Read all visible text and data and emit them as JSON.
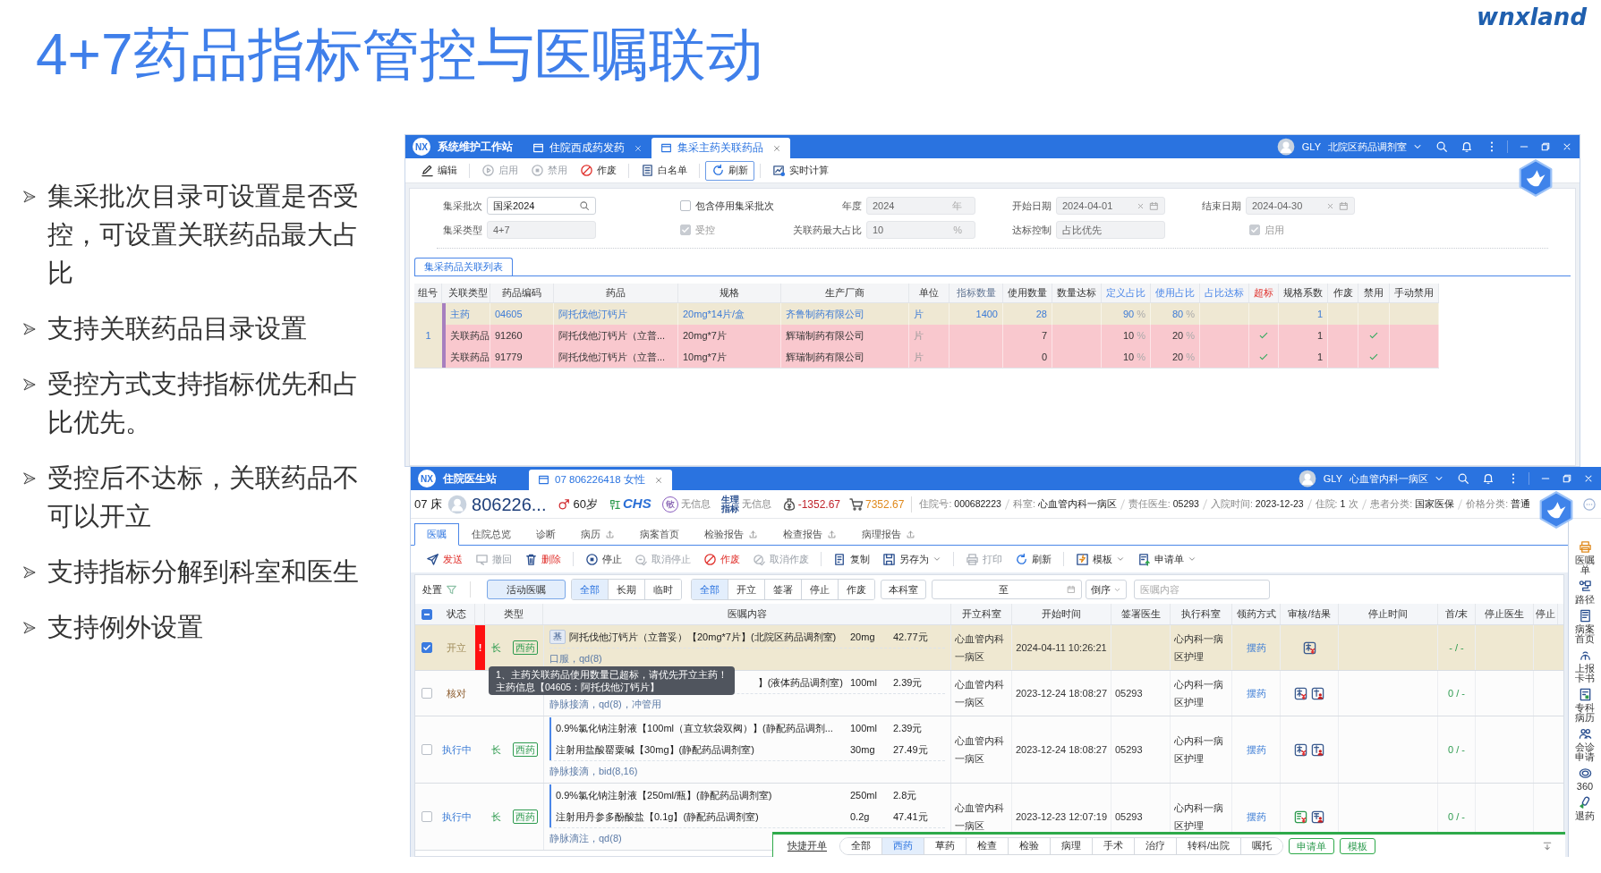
{
  "slide": {
    "title": "4+7药品指标管控与医嘱联动",
    "logo": "wnxland",
    "bullets": [
      "集采批次目录可设置是否受控，可设置关联药品最大占比",
      "支持关联药品目录设置",
      "受控方式支持指标优先和占比优先。",
      "受控后不达标，关联药品不可以开立",
      "支持指标分解到科室和医生",
      "支持例外设置"
    ]
  },
  "config_window": {
    "logo": "NX",
    "app_title": "系统维护工作站",
    "tabs": [
      {
        "label": "住院西成药发药",
        "selected": false
      },
      {
        "label": "集采主药关联药品",
        "selected": true
      }
    ],
    "user": "GLY",
    "department": "北院区药品调剂室",
    "toolbar_groups": [
      [
        {
          "label": "编辑",
          "disabled": false,
          "focused": false
        }
      ],
      [
        {
          "label": "启用",
          "disabled": true,
          "focused": false
        },
        {
          "label": "禁用",
          "disabled": true,
          "focused": false
        },
        {
          "label": "作废",
          "disabled": false,
          "focused": false
        }
      ],
      [
        {
          "label": "白名单",
          "disabled": false,
          "focused": false
        }
      ],
      [
        {
          "label": "刷新",
          "disabled": false,
          "focused": true
        }
      ],
      [
        {
          "label": "实时计算",
          "disabled": false,
          "focused": false
        }
      ]
    ],
    "form_rows": [
      [
        {
          "kind": "search",
          "label": "集采批次",
          "value": "国采2024",
          "disabled": false
        },
        {
          "kind": "checkbox",
          "label": "包含停用集采批次",
          "checked": false,
          "disabled": false
        },
        {
          "kind": "text",
          "label": "年度",
          "value": "2024",
          "suffix": "年",
          "disabled": true
        },
        {
          "kind": "date",
          "label": "开始日期",
          "value": "2024-04-01",
          "disabled": true
        },
        {
          "kind": "date",
          "label": "结束日期",
          "value": "2024-04-30",
          "disabled": true
        }
      ],
      [
        {
          "kind": "text",
          "label": "集采类型",
          "value": "4+7",
          "disabled": true
        },
        {
          "kind": "checkbox",
          "label": "受控",
          "checked": true,
          "disabled": true
        },
        {
          "kind": "text",
          "label": "关联药最大占比",
          "value": "10",
          "suffix": "%",
          "disabled": true
        },
        {
          "kind": "text",
          "label": "达标控制",
          "value": "占比优先",
          "disabled": true
        },
        {
          "kind": "checkbox",
          "label": "启用",
          "checked": true,
          "disabled": true
        }
      ]
    ],
    "list_tabs": [
      {
        "label": "集采药品关联列表",
        "selected": true
      }
    ],
    "columns": [
      {
        "label": "组号",
        "kind": "plain"
      },
      {
        "label": "关联类型",
        "kind": "plain"
      },
      {
        "label": "药品编码",
        "kind": "plain"
      },
      {
        "label": "药品",
        "kind": "plain"
      },
      {
        "label": "规格",
        "kind": "plain"
      },
      {
        "label": "生产厂商",
        "kind": "plain"
      },
      {
        "label": "单位",
        "kind": "plain"
      },
      {
        "label": "指标数量",
        "kind": "quota"
      },
      {
        "label": "使用数量",
        "kind": "plain"
      },
      {
        "label": "数量达标",
        "kind": "plain"
      },
      {
        "label": "定义占比",
        "kind": "ratio"
      },
      {
        "label": "使用占比",
        "kind": "ratio"
      },
      {
        "label": "占比达标",
        "kind": "ratio"
      },
      {
        "label": "超标",
        "kind": "alert"
      },
      {
        "label": "规格系数",
        "kind": "plain"
      },
      {
        "label": "作废",
        "kind": "plain"
      },
      {
        "label": "禁用",
        "kind": "plain"
      },
      {
        "label": "手动禁用",
        "kind": "plain"
      }
    ],
    "groups": [
      {
        "number": "1",
        "rows": [
          {
            "kind": "main",
            "type": "主药",
            "code": "04605",
            "drug": "阿托伐他汀钙片",
            "spec": "20mg*14片/盒",
            "maker": "齐鲁制药有限公司",
            "unit": "片",
            "target_qty": "1400",
            "used_qty": "28",
            "defined_ratio": {
              "value": "90",
              "unit": "%"
            },
            "used_ratio": {
              "value": "80",
              "unit": "%"
            },
            "over_limit": false,
            "factor": "1",
            "banned": false
          },
          {
            "kind": "linked",
            "type": "关联药品",
            "code": "91260",
            "drug": "阿托伐他汀钙片（立普...",
            "spec": "20mg*7片",
            "maker": "辉瑞制药有限公司",
            "unit": "片",
            "used_qty": "7",
            "defined_ratio": {
              "value": "10",
              "unit": "%"
            },
            "used_ratio": {
              "value": "20",
              "unit": "%"
            },
            "over_limit": true,
            "factor": "1",
            "banned": true
          },
          {
            "kind": "linked",
            "type": "关联药品",
            "code": "91779",
            "drug": "阿托伐他汀钙片（立普...",
            "spec": "10mg*7片",
            "maker": "辉瑞制药有限公司",
            "unit": "片",
            "used_qty": "0",
            "defined_ratio": {
              "value": "10",
              "unit": "%"
            },
            "used_ratio": {
              "value": "20",
              "unit": "%"
            },
            "over_limit": true,
            "factor": "1",
            "banned": true
          }
        ]
      }
    ]
  },
  "doctor_window": {
    "logo": "NX",
    "app_title": "住院医生站",
    "tabs": [
      {
        "label": "07 806226418 女性",
        "selected": true
      }
    ],
    "user": "GLY",
    "department": "心血管内科一病区",
    "patient": {
      "bed": "07 床",
      "id": "806226...",
      "age": "60岁",
      "insurance": "CHS",
      "allergy_badge": "敏",
      "allergy": "无信息",
      "vitals_badge": "生理指标",
      "vitals": "无信息",
      "balance": "-1352.67",
      "cost": "7352.67",
      "info": [
        {
          "label": "住院号:",
          "value": "000682223"
        },
        {
          "label": "科室:",
          "value": "心血管内科一病区"
        },
        {
          "label": "责任医生:",
          "value": "05293"
        },
        {
          "label": "入院时间:",
          "value": "2023-12-23"
        },
        {
          "label": "住院:",
          "value": "1",
          "suffix": "次"
        },
        {
          "label": "患者分类:",
          "value": "国家医保"
        },
        {
          "label": "价格分类:",
          "value": "普通"
        }
      ]
    },
    "record_tabs": [
      {
        "label": "医嘱",
        "selected": true,
        "upload": false
      },
      {
        "label": "住院总览",
        "selected": false,
        "upload": false
      },
      {
        "label": "诊断",
        "selected": false,
        "upload": false
      },
      {
        "label": "病历",
        "selected": false,
        "upload": true
      },
      {
        "label": "病案首页",
        "selected": false,
        "upload": false
      },
      {
        "label": "检验报告",
        "selected": false,
        "upload": true
      },
      {
        "label": "检查报告",
        "selected": false,
        "upload": true
      },
      {
        "label": "病理报告",
        "selected": false,
        "upload": true
      }
    ],
    "toolbar_groups": [
      [
        {
          "label": "发送",
          "kind": "danger",
          "disabled": false,
          "dropdown": false
        },
        {
          "label": "撤回",
          "disabled": true,
          "dropdown": false
        },
        {
          "label": "删除",
          "kind": "danger",
          "disabled": false,
          "dropdown": false
        }
      ],
      [
        {
          "label": "停止",
          "kind": "plain",
          "disabled": false,
          "dropdown": false
        },
        {
          "label": "取消停止",
          "disabled": true,
          "dropdown": false
        },
        {
          "label": "作废",
          "kind": "danger",
          "disabled": false,
          "dropdown": false
        },
        {
          "label": "取消作废",
          "disabled": true,
          "dropdown": false
        }
      ],
      [
        {
          "label": "复制",
          "kind": "plain",
          "disabled": false,
          "dropdown": false
        },
        {
          "label": "另存为",
          "kind": "plain",
          "disabled": false,
          "dropdown": true
        }
      ],
      [
        {
          "label": "打印",
          "disabled": true,
          "dropdown": false
        },
        {
          "label": "刷新",
          "kind": "plain",
          "disabled": false,
          "dropdown": false
        }
      ],
      [
        {
          "label": "模板",
          "kind": "plain",
          "disabled": false,
          "dropdown": true
        },
        {
          "label": "申请单",
          "kind": "plain",
          "disabled": false,
          "dropdown": true
        }
      ]
    ],
    "filters": {
      "label": "处置",
      "scope": {
        "label": "活动医嘱",
        "selected": true
      },
      "durations": [
        {
          "label": "全部",
          "selected": true
        },
        {
          "label": "长期",
          "selected": false
        },
        {
          "label": "临时",
          "selected": false
        }
      ],
      "statuses": [
        {
          "label": "全部",
          "selected": true
        },
        {
          "label": "开立",
          "selected": false
        },
        {
          "label": "签署",
          "selected": false
        },
        {
          "label": "停止",
          "selected": false
        },
        {
          "label": "作废",
          "selected": false
        }
      ],
      "dept_button": "本科室",
      "range_separator": "至",
      "order": "倒序",
      "search_placeholder": "医嘱内容"
    },
    "select_all": {
      "checked": true,
      "partial": true
    },
    "columns": [
      "状态",
      "类型",
      "医嘱内容",
      "开立科室",
      "开始时间",
      "签署医生",
      "执行科室",
      "领药方式",
      "审核/结果",
      "停止时间",
      "首/末",
      "停止医生",
      "停止"
    ],
    "orders": [
      {
        "selected": true,
        "status": "开立",
        "kind": "open",
        "alert": "!",
        "term": "长",
        "category": "西药",
        "items": [
          {
            "badge": "基",
            "name": "阿托伐他汀钙片（立普妥）【20mg*7片】(北院区药品调剂室)",
            "dose": "20mg",
            "price": "42.77元"
          }
        ],
        "usage": "口服，qd(8)",
        "dept": "心血管内科一病区",
        "start": "2024-04-11 10:26:21",
        "exec_dept": "心内科一病区护理",
        "dispense": "摆药",
        "review": [
          {
            "kind": "fee"
          }
        ],
        "first_last": "- / -"
      },
      {
        "selected": false,
        "status": "核对",
        "kind": "verify",
        "items": [
          {
            "name": "】(液体药品调剂室)",
            "dose": "100ml",
            "price": "2.39元"
          }
        ],
        "usage": "静脉接滴，qd(8)，冲管用",
        "dept": "心血管内科一病区",
        "start": "2023-12-24 18:08:27",
        "doctor": "05293",
        "exec_dept": "心内科一病区护理",
        "dispense": "摆药",
        "review": [
          {
            "kind": "fee"
          },
          {
            "kind": "sign"
          }
        ],
        "first_last": "0 / -"
      },
      {
        "selected": false,
        "status": "执行中",
        "kind": "running",
        "term": "长",
        "category": "西药",
        "items": [
          {
            "name": "0.9%氯化钠注射液【100ml（直立软袋双阀）】(静配药品调剂...",
            "dose": "100ml",
            "price": "2.39元"
          },
          {
            "name": "注射用盐酸罂粟碱【30mg】(静配药品调剂室)",
            "dose": "30mg",
            "price": "27.49元"
          }
        ],
        "usage": "静脉接滴，bid(8,16)",
        "dept": "心血管内科一病区",
        "start": "2023-12-24 18:08:27",
        "doctor": "05293",
        "exec_dept": "心内科一病区护理",
        "dispense": "摆药",
        "review": [
          {
            "kind": "fee"
          },
          {
            "kind": "sign"
          }
        ],
        "first_last": "0 / -"
      },
      {
        "selected": false,
        "status": "执行中",
        "kind": "running",
        "term": "长",
        "category": "西药",
        "items": [
          {
            "name": "0.9%氯化钠注射液【250ml/瓶】(静配药品调剂室)",
            "dose": "250ml",
            "price": "2.8元"
          },
          {
            "name": "注射用丹参多酚酸盐【0.1g】(静配药品调剂室)",
            "dose": "0.2g",
            "price": "47.41元"
          }
        ],
        "usage": "静脉滴注，qd(8)",
        "dept": "心血管内科一病区",
        "start": "2023-12-23 12:07:19",
        "doctor": "05293",
        "exec_dept": "心内科一病区护理",
        "dispense": "摆药",
        "review": [
          {
            "kind": "record"
          },
          {
            "kind": "notice"
          }
        ],
        "first_last": "0 / -"
      }
    ],
    "tooltip": "1、主药关联药品使用数量已超标，请优先开立主药！主药信息【04605：阿托伐他汀钙片】",
    "quick_order": {
      "title": "快捷开单",
      "tabs": [
        {
          "label": "全部",
          "selected": false
        },
        {
          "label": "西药",
          "selected": true
        },
        {
          "label": "草药",
          "selected": false
        },
        {
          "label": "检查",
          "selected": false
        },
        {
          "label": "检验",
          "selected": false
        },
        {
          "label": "病理",
          "selected": false
        },
        {
          "label": "手术",
          "selected": false
        },
        {
          "label": "治疗",
          "selected": false
        },
        {
          "label": "转科/出院",
          "selected": false
        },
        {
          "label": "嘱托",
          "selected": false
        }
      ],
      "buttons": [
        "申请单",
        "模板"
      ]
    },
    "side_tools": [
      "医嘱单",
      "路径",
      "病案首页",
      "上报卡书",
      "专科病历",
      "会诊申请",
      "360",
      "退药"
    ]
  }
}
